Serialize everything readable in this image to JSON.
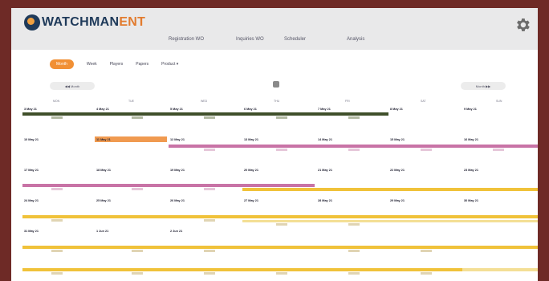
{
  "brand": {
    "name_a": "WATCHMAN",
    "name_b": "ENT",
    "color_primary": "#1f3a5a",
    "color_accent": "#e27b2e"
  },
  "nav": [
    "Registration WO",
    "Inquiries WO",
    "Scheduler",
    "Analysis"
  ],
  "toolbar": {
    "active": "Month",
    "items": [
      "Week",
      "Players",
      "Papers",
      "Product"
    ],
    "product_caret": "▾"
  },
  "pager": {
    "prev": "◀◀  Month",
    "next": "Month  ▶▶"
  },
  "days": [
    "MON",
    "TUE",
    "WED",
    "THU",
    "FRI",
    "SAT",
    "SUN"
  ],
  "weeks": [
    {
      "dates": [
        "3 May 21",
        "4 May 21",
        "5 May 21",
        "6 May 21",
        "7 May 21",
        "8 May 21",
        "9 May 21"
      ]
    },
    {
      "dates": [
        "10 May 21",
        "11 May 21",
        "12 May 21",
        "13 May 21",
        "14 May 21",
        "15 May 21",
        "16 May 21"
      ]
    },
    {
      "dates": [
        "17 May 21",
        "18 May 21",
        "19 May 21",
        "20 May 21",
        "21 May 21",
        "22 May 21",
        "23 May 21"
      ]
    },
    {
      "dates": [
        "24 May 21",
        "25 May 21",
        "26 May 21",
        "27 May 21",
        "28 May 21",
        "29 May 21",
        "30 May 21"
      ]
    },
    {
      "dates": [
        "31 May 21",
        "1 Jun 21",
        "2 Jun 21",
        "",
        "",
        "",
        ""
      ]
    }
  ],
  "colors": {
    "green": "#3f4f2a",
    "orange": "#f09a50",
    "pink": "#c873a6",
    "yellow": "#f0c23a",
    "yellow_light": "#f4df95"
  }
}
